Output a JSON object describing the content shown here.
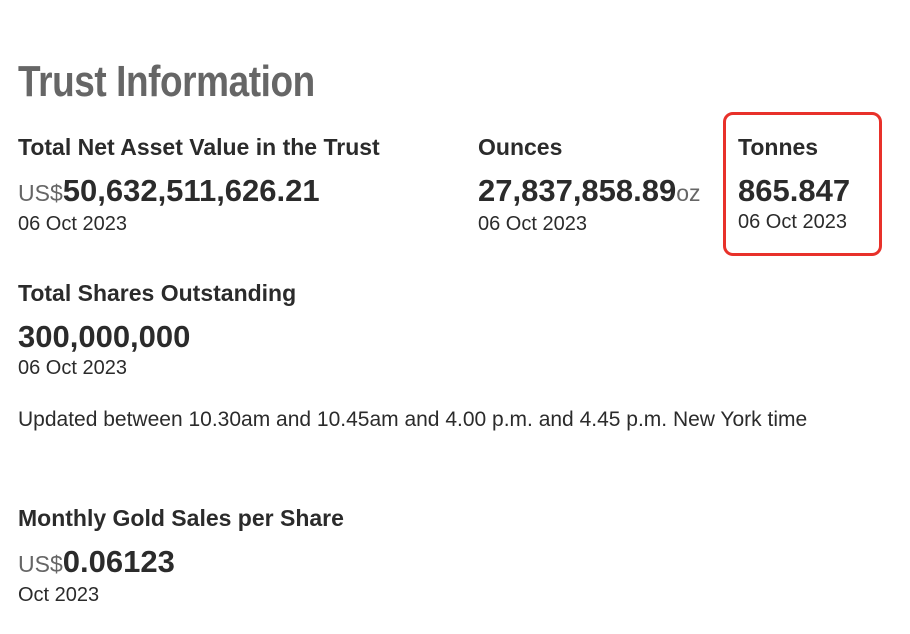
{
  "page": {
    "title": "Trust Information"
  },
  "nav_block": {
    "label": "Total Net Asset Value in the Trust",
    "prefix": "US$",
    "value": "50,632,511,626.21",
    "date": "06 Oct 2023"
  },
  "ounces_block": {
    "label": "Ounces",
    "value": "27,837,858.89",
    "suffix": "oz",
    "date": "06 Oct 2023"
  },
  "tonnes_block": {
    "label": "Tonnes",
    "value": "865.847",
    "date": "06 Oct 2023"
  },
  "shares_block": {
    "label": "Total Shares Outstanding",
    "value": "300,000,000",
    "date": "06 Oct 2023"
  },
  "update_note": "Updated between 10.30am and 10.45am and 4.00 p.m. and 4.45 p.m. New York time",
  "gold_sales_block": {
    "label": "Monthly Gold Sales per Share",
    "prefix": "US$",
    "value": "0.06123",
    "date": "Oct 2023"
  },
  "colors": {
    "title": "#666666",
    "text": "#2b2b2b",
    "highlight_border": "#e8312a"
  }
}
